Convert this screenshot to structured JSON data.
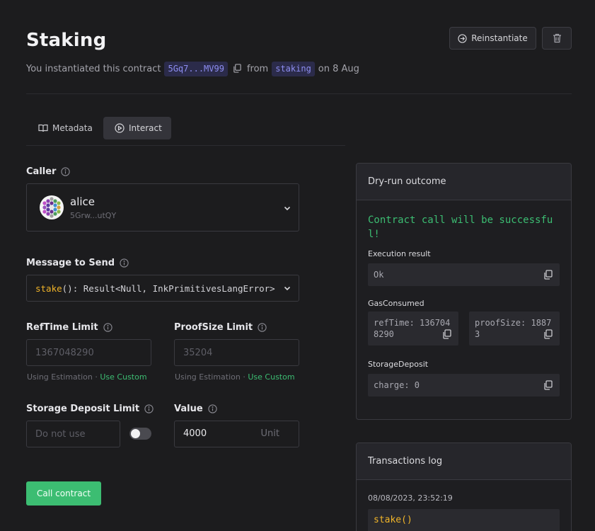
{
  "header": {
    "title": "Staking",
    "subtitle_prefix": "You instantiated this contract",
    "address_chip": "5Gq7...MV99",
    "from_text": "from",
    "code_chip": "staking",
    "date_text": "on 8 Aug",
    "reinstantiate_label": "Reinstantiate"
  },
  "tabs": [
    {
      "label": "Metadata",
      "icon": "book-icon"
    },
    {
      "label": "Interact",
      "icon": "play-circle-icon",
      "active": true
    }
  ],
  "form": {
    "caller_label": "Caller",
    "caller_name": "alice",
    "caller_address": "5Grw...utQY",
    "message_label": "Message to Send",
    "message_fn": "stake",
    "message_rest": "(): Result<Null, InkPrimitivesLangError>",
    "reftime_label": "RefTime Limit",
    "reftime_placeholder": "1367048290",
    "proofsize_label": "ProofSize Limit",
    "proofsize_placeholder": "35204",
    "using_estimation": "Using Estimation",
    "separator": "·",
    "use_custom": "Use Custom",
    "storage_label": "Storage Deposit Limit",
    "storage_placeholder": "Do not use",
    "value_label": "Value",
    "value_input": "4000",
    "value_unit": "Unit",
    "call_button": "Call contract"
  },
  "dry_run": {
    "title": "Dry-run outcome",
    "status": "Contract call will be successful!",
    "execution_label": "Execution result",
    "execution_value": "Ok",
    "gas_label": "GasConsumed",
    "ref_time": "refTime: 1367048290",
    "proof_size": "proofSize: 18873",
    "storage_label": "StorageDeposit",
    "storage_value": "charge: 0"
  },
  "tx_log": {
    "title": "Transactions log",
    "timestamp": "08/08/2023, 23:52:19",
    "entry": "stake()"
  },
  "colors": {
    "background": "#1c1c1e",
    "accent_green": "#3cbd72",
    "chip_bg": "#2b2b4a",
    "chip_text": "#8e8ef2",
    "fn_yellow": "#f0b429"
  }
}
